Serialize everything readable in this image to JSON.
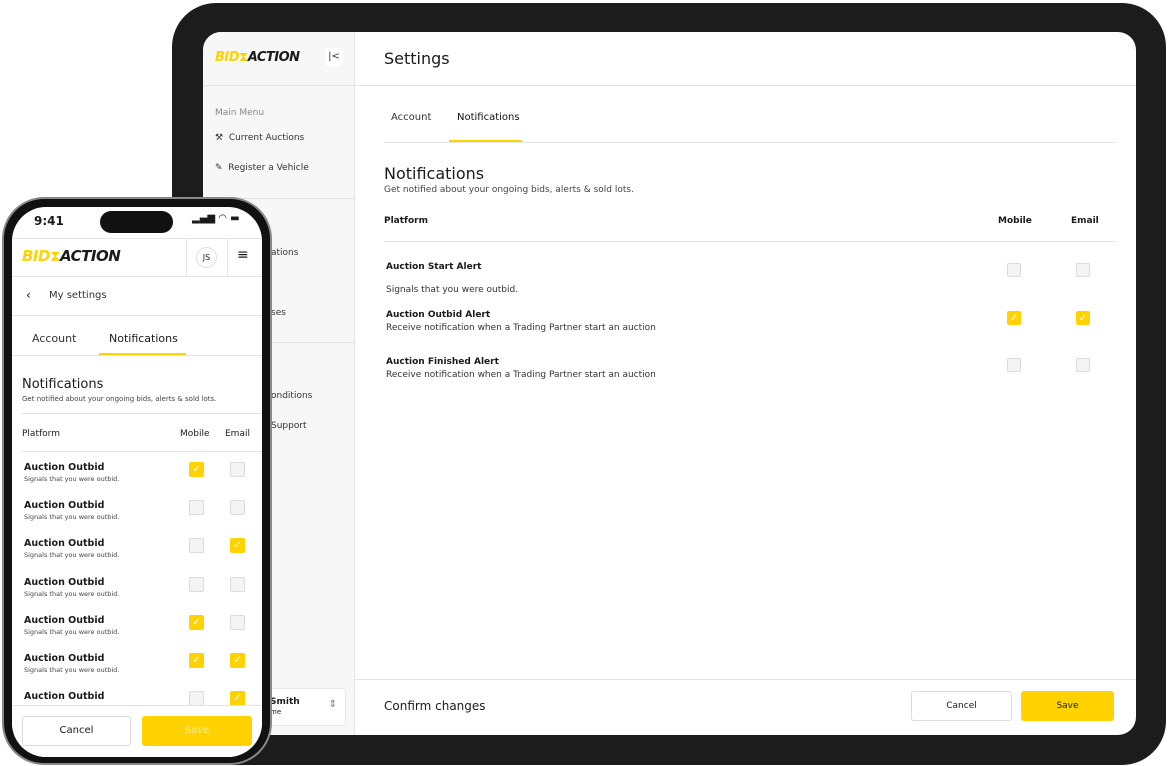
{
  "brand": {
    "logo_part1": "BID",
    "logo_part2": "ACTION",
    "accent": "#FFD200"
  },
  "tablet": {
    "sidebar": {
      "section_label": "Main Menu",
      "items": [
        {
          "label": "Current Auctions",
          "icon": "gavel-icon"
        },
        {
          "label": "Register a Vehicle",
          "icon": "pencil-icon"
        }
      ],
      "partial_items": [
        "ations",
        "ses",
        "onditions",
        "Support"
      ],
      "user_name_partial": "Smith",
      "user_sub_partial": "me"
    },
    "header": {
      "title": "Settings"
    },
    "tabs": [
      {
        "label": "Account"
      },
      {
        "label": "Notifications",
        "active": true
      }
    ],
    "section": {
      "title": "Notifications",
      "subtitle": "Get notified about your ongoing bids, alerts & sold lots."
    },
    "table": {
      "col_platform": "Platform",
      "col_mobile": "Mobile",
      "col_email": "Email",
      "rows": [
        {
          "title": "Auction Start Alert",
          "desc": "Signals that you were outbid.",
          "mobile": false,
          "email": false
        },
        {
          "title": "Auction Outbid Alert",
          "desc": "Receive notification when a Trading Partner start an auction",
          "mobile": true,
          "email": true
        },
        {
          "title": "Auction Finished Alert",
          "desc": "Receive notification when a Trading Partner start an auction",
          "mobile": false,
          "email": false
        }
      ]
    },
    "footer": {
      "label": "Confirm changes",
      "cancel": "Cancel",
      "save": "Save"
    }
  },
  "phone": {
    "status": {
      "time": "9:41"
    },
    "avatar": "JS",
    "back_label": "My settings",
    "tabs": [
      {
        "label": "Account"
      },
      {
        "label": "Notifications",
        "active": true
      }
    ],
    "section": {
      "title": "Notifications",
      "subtitle": "Get notified about your ongoing bids, alerts & sold lots."
    },
    "table": {
      "col_platform": "Platform",
      "col_mobile": "Mobile",
      "col_email": "Email",
      "rows": [
        {
          "title": "Auction Outbid",
          "desc": "Signals that you were outbid.",
          "mobile": true,
          "email": false
        },
        {
          "title": "Auction Outbid",
          "desc": "Signals that you were outbid.",
          "mobile": false,
          "email": false
        },
        {
          "title": "Auction Outbid",
          "desc": "Signals that you were outbid.",
          "mobile": false,
          "email": true
        },
        {
          "title": "Auction Outbid",
          "desc": "Signals that you were outbid.",
          "mobile": false,
          "email": false
        },
        {
          "title": "Auction Outbid",
          "desc": "Signals that you were outbid.",
          "mobile": true,
          "email": false
        },
        {
          "title": "Auction Outbid",
          "desc": "Signals that you were outbid.",
          "mobile": true,
          "email": true
        },
        {
          "title": "Auction Outbid",
          "desc": "",
          "mobile": false,
          "email": true
        }
      ]
    },
    "footer": {
      "cancel": "Cancel",
      "save": "Save"
    }
  }
}
